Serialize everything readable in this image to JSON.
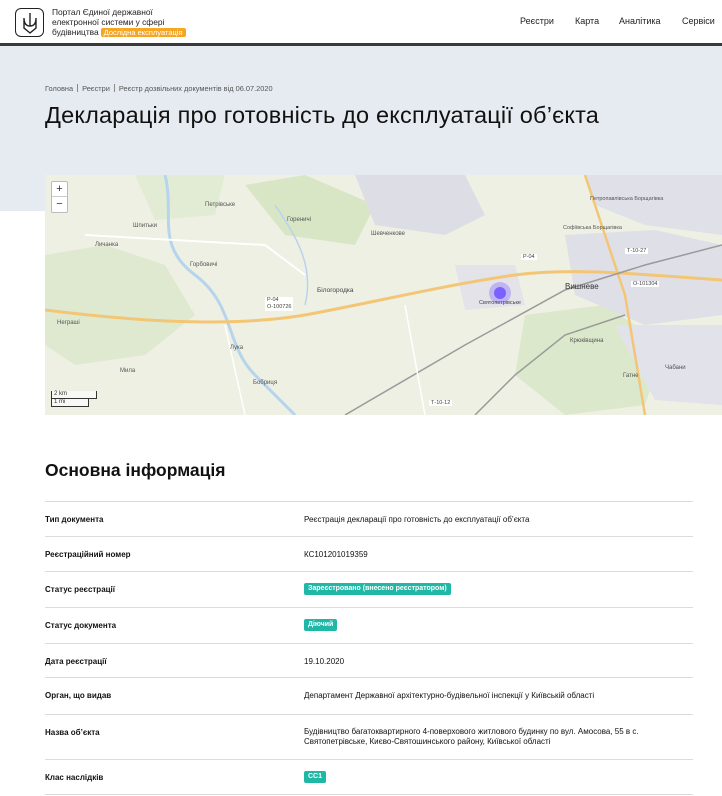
{
  "header": {
    "brand_lines": [
      "Портал Єдиної державної",
      "електронної системи у сфері",
      "будівництва"
    ],
    "beta": "Дослідна експлуатація",
    "nav": [
      "Реєстри",
      "Карта",
      "Аналітика",
      "Сервіси"
    ]
  },
  "breadcrumbs": [
    "Головна",
    "Реєстри",
    "Реєстр дозвільних документів від 06.07.2020"
  ],
  "page_title": "Декларація про готовність до експлуатації об’єкта",
  "map": {
    "zoom_in": "+",
    "zoom_out": "−",
    "scale_km": "2 km",
    "scale_mi": "1 mi",
    "place_labels": [
      "Петрівське",
      "Горбовичі",
      "Шпитьки",
      "Гореничі",
      "Білогородка",
      "Шевченкове",
      "Святопетрівське",
      "Вишневе",
      "Софіївська Борщагівка",
      "Петропавлівська Борщагівка",
      "Чабани",
      "Гатне",
      "Крюківщина",
      "Бобриця",
      "Мила",
      "Лука",
      "Неграші",
      "Личанка"
    ],
    "road_labels": [
      "Р-04",
      "О-100726",
      "Р-04",
      "О-101304",
      "Т-10-27",
      "Т-10-12"
    ],
    "marker_color": "#7b61ff"
  },
  "info": {
    "section_title": "Основна інформація",
    "rows": [
      {
        "label": "Тип документа",
        "value": "Реєстрація декларації про готовність до експлуатації об’єкта"
      },
      {
        "label": "Реєстраційний номер",
        "value": "КС101201019359"
      },
      {
        "label": "Статус реєстрації",
        "badge": "Зареєстровано (внесено реєстратором)"
      },
      {
        "label": "Статус документа",
        "badge": "Діючий"
      },
      {
        "label": "Дата реєстрації",
        "value": "19.10.2020"
      },
      {
        "label": "Орган, що видав",
        "value": "Департамент Державної архітектурно-будівельної інспекції у Київській області"
      },
      {
        "label": "Назва об’єкта",
        "value": "Будівництво багатоквартирного 4-поверхового житлового будинку по вул. Амосова, 55 в с. Святопетрівське, Києво-Святошинського району, Київської області"
      },
      {
        "label": "Клас наслідків",
        "badge": "СС1"
      }
    ]
  },
  "colors": {
    "badge": "#1fb8a6",
    "beta": "#f5a623",
    "hero_bg": "#e6ebf2"
  }
}
